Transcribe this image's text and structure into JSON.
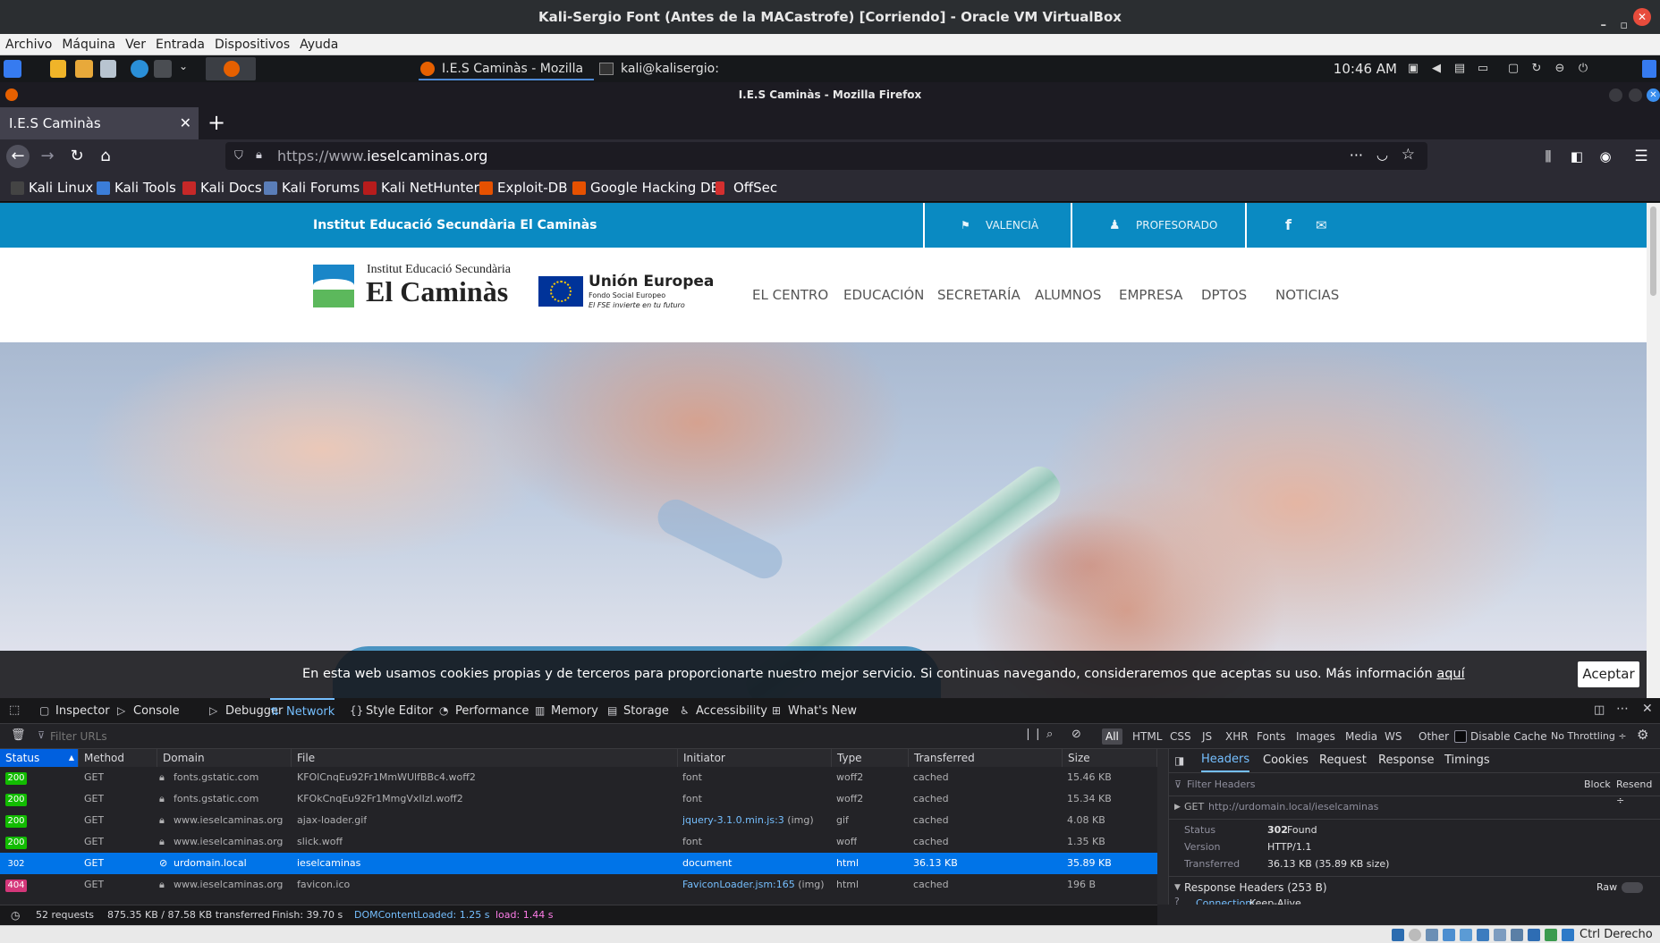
{
  "vbox": {
    "title": "Kali-Sergio Font (Antes de la MACastrofe) [Corriendo] - Oracle VM VirtualBox",
    "menu": [
      "Archivo",
      "Máquina",
      "Ver",
      "Entrada",
      "Dispositivos",
      "Ayuda"
    ],
    "host_key": "Ctrl Derecho"
  },
  "panel": {
    "tasks": [
      "I.E.S Caminàs - Mozilla ...",
      "kali@kalisergio: /etc/ap..."
    ],
    "clock": "10:46 AM"
  },
  "firefox": {
    "window_title": "I.E.S Caminàs - Mozilla Firefox",
    "tab_title": "I.E.S Caminàs",
    "url_prefix": "https://www.",
    "url_domain": "ieselcaminas.org",
    "bookmarks": [
      "Kali Linux",
      "Kali Tools",
      "Kali Docs",
      "Kali Forums",
      "Kali NetHunter",
      "Exploit-DB",
      "Google Hacking DB",
      "OffSec"
    ]
  },
  "site": {
    "topbar_title": "Institut Educació Secundària El Caminàs",
    "lang_link": "VALENCIÀ",
    "staff_link": "PROFESORADO",
    "logo_subtitle": "Institut Educació Secundària",
    "logo_title": "El Caminàs",
    "eu_title": "Unión Europea",
    "eu_line1": "Fondo Social Europeo",
    "eu_line2": "El FSE invierte en tu futuro",
    "menu": [
      "EL CENTRO",
      "EDUCACIÓN",
      "SECRETARÍA",
      "ALUMNOS",
      "EMPRESA",
      "DPTOS",
      "NOTICIAS"
    ],
    "cookie_text": "En esta web usamos cookies propias y de terceros para proporcionarte nuestro mejor servicio. Si continuas navegando, consideraremos que aceptas su uso. Más información ",
    "cookie_link": "aquí",
    "cookie_button": "Aceptar"
  },
  "devtools": {
    "tabs": [
      "Inspector",
      "Console",
      "Debugger",
      "Network",
      "Style Editor",
      "Performance",
      "Memory",
      "Storage",
      "Accessibility",
      "What's New"
    ],
    "filter_placeholder": "Filter URLs",
    "types": [
      "All",
      "HTML",
      "CSS",
      "JS",
      "XHR",
      "Fonts",
      "Images",
      "Media",
      "WS",
      "Other"
    ],
    "disable_cache": "Disable Cache",
    "throttling": "No Throttling ÷",
    "columns": [
      "Status",
      "Method",
      "Domain",
      "File",
      "Initiator",
      "Type",
      "Transferred",
      "Size"
    ],
    "rows": [
      {
        "status": "200",
        "method": "GET",
        "domain": "fonts.gstatic.com",
        "file": "KFOlCnqEu92Fr1MmWUlfBBc4.woff2",
        "initiator": "font",
        "initiator_extra": "",
        "type": "woff2",
        "transferred": "cached",
        "size": "15.46 KB"
      },
      {
        "status": "200",
        "method": "GET",
        "domain": "fonts.gstatic.com",
        "file": "KFOkCnqEu92Fr1MmgVxIIzI.woff2",
        "initiator": "font",
        "initiator_extra": "",
        "type": "woff2",
        "transferred": "cached",
        "size": "15.34 KB"
      },
      {
        "status": "200",
        "method": "GET",
        "domain": "www.ieselcaminas.org",
        "file": "ajax-loader.gif",
        "initiator": "jquery-3.1.0.min.js:3",
        "initiator_extra": " (img)",
        "type": "gif",
        "transferred": "cached",
        "size": "4.08 KB"
      },
      {
        "status": "200",
        "method": "GET",
        "domain": "www.ieselcaminas.org",
        "file": "slick.woff",
        "initiator": "font",
        "initiator_extra": "",
        "type": "woff",
        "transferred": "cached",
        "size": "1.35 KB"
      },
      {
        "status": "302",
        "method": "GET",
        "domain": "urdomain.local",
        "file": "ieselcaminas",
        "initiator": "document",
        "initiator_extra": "",
        "type": "html",
        "transferred": "36.13 KB",
        "size": "35.89 KB"
      },
      {
        "status": "404",
        "method": "GET",
        "domain": "www.ieselcaminas.org",
        "file": "favicon.ico",
        "initiator": "FaviconLoader.jsm:165",
        "initiator_extra": " (img)",
        "type": "html",
        "transferred": "cached",
        "size": "196 B"
      }
    ],
    "side_tabs": [
      "Headers",
      "Cookies",
      "Request",
      "Response",
      "Timings"
    ],
    "filter_headers": "Filter Headers",
    "block": "Block",
    "resend": "Resend ÷",
    "request_line_method": "GET",
    "request_line_url": "http://urdomain.local/ieselcaminas",
    "status_label": "Status",
    "status_code": "302",
    "status_text": "Found",
    "version_label": "Version",
    "version_value": "HTTP/1.1",
    "transferred_label": "Transferred",
    "transferred_value": "36.13 KB (35.89 KB size)",
    "response_headers": "Response Headers (253 B)",
    "raw": "Raw",
    "connection_label": "Connection:",
    "connection_value": "Keep-Alive",
    "summary_requests": "52 requests",
    "summary_size": "875.35 KB / 87.58 KB transferred",
    "summary_finish": "Finish: 39.70 s",
    "summary_dcl": "DOMContentLoaded: 1.25 s",
    "summary_load": "load: 1.44 s"
  }
}
